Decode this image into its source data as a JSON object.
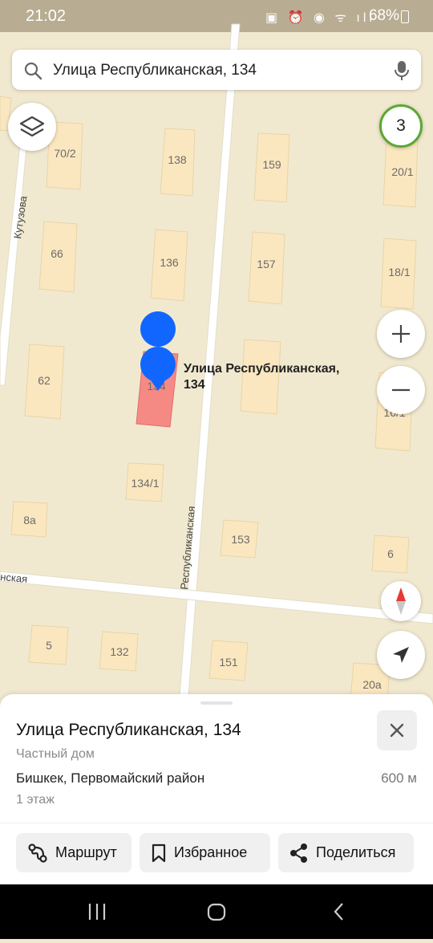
{
  "status": {
    "time": "21:02",
    "icons": "▣ ⏰ ◉ ᯤ ıll",
    "battery": "68%"
  },
  "search": {
    "text": "Улица Республиканская, 134"
  },
  "map": {
    "badge_count": "3",
    "pin_label_line1": "Улица Республиканская,",
    "pin_label_line2": "134",
    "streets": {
      "kutuzova": "Кутузова",
      "respublikanskaya": "Республиканская",
      "left_partial": "нская"
    },
    "buildings": {
      "b70_2": "70/2",
      "b138": "138",
      "b159": "159",
      "b20_1": "20/1",
      "b66": "66",
      "b136": "136",
      "b157": "157",
      "b18_1": "18/1",
      "b62": "62",
      "b134": "134",
      "b16_1": "16/1",
      "b134_1": "134/1",
      "b8a": "8а",
      "b153": "153",
      "b6": "6",
      "b5": "5",
      "b132": "132",
      "b151": "151",
      "b20a": "20а"
    },
    "colors": {
      "ground": "#f1e9cf",
      "building": "#fbe7bf",
      "selected_building": "#f58a84",
      "pin": "#1166ff"
    }
  },
  "sheet": {
    "title": "Улица Республиканская, 134",
    "type": "Частный дом",
    "address": "Бишкек, Первомайский район",
    "distance": "600 м",
    "floors": "1 этаж",
    "actions": {
      "route": "Маршрут",
      "favorite": "Избранное",
      "share": "Поделиться"
    }
  }
}
